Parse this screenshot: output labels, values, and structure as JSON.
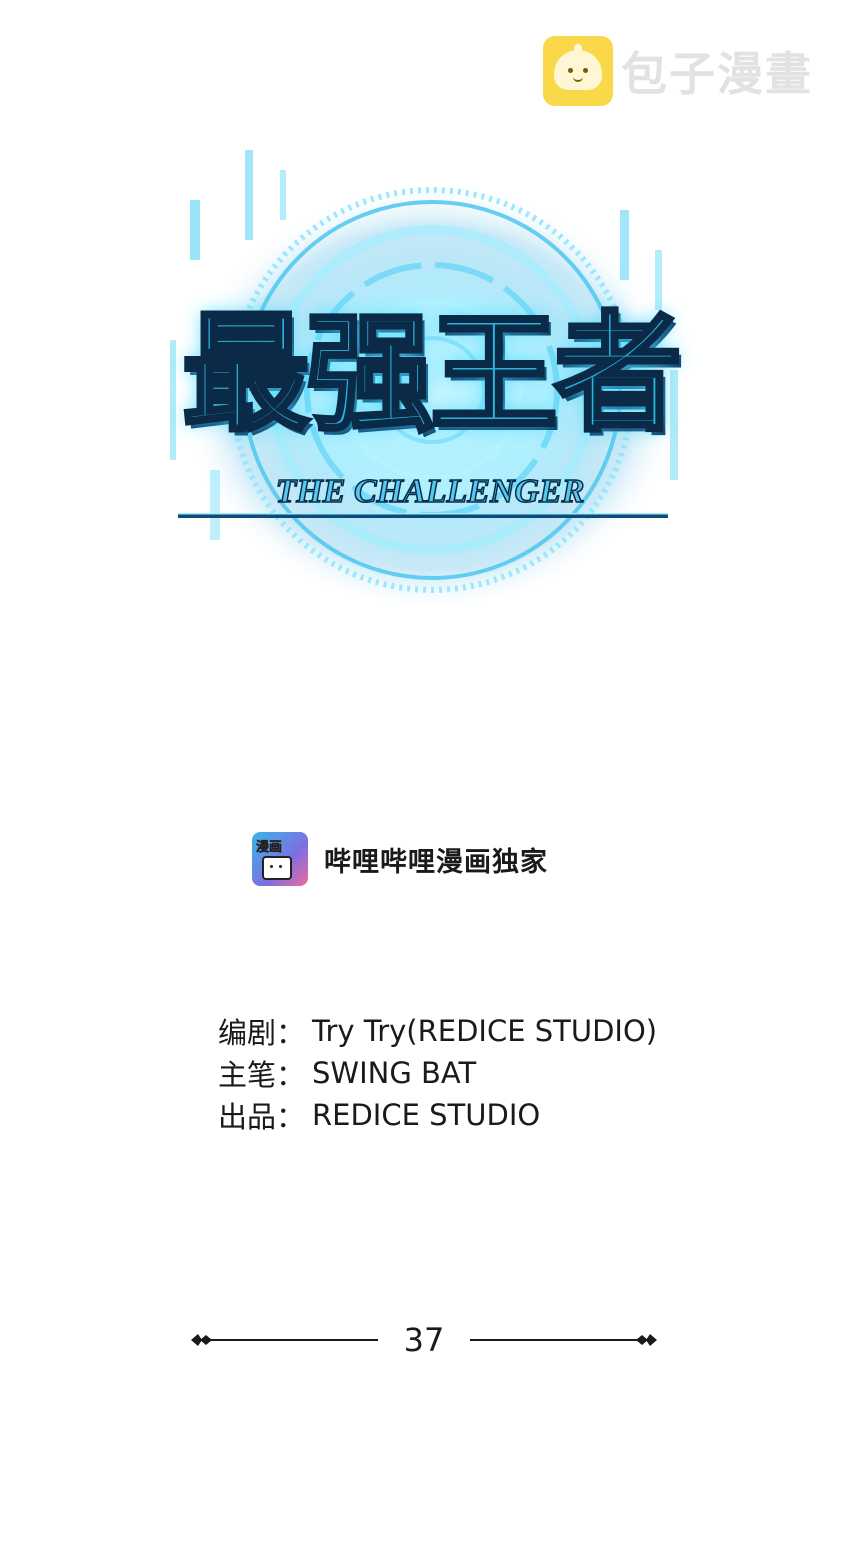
{
  "watermark": {
    "icon": "steamed-bun-icon",
    "text": "包子漫畫"
  },
  "logo": {
    "title": "最强王者",
    "subtitle": "THE CHALLENGER",
    "colors": {
      "primary": "#2ab5dc",
      "outline": "#0a2a48",
      "glow": "#6fe3ff"
    }
  },
  "exclusive": {
    "icon": "bilibili-manga-app-icon",
    "icon_text": "漫画",
    "text": "哔哩哔哩漫画独家"
  },
  "credits": [
    {
      "label": "编剧：",
      "value": "Try Try(REDICE STUDIO)"
    },
    {
      "label": "主笔：",
      "value": "SWING BAT"
    },
    {
      "label": "出品：",
      "value": "REDICE STUDIO"
    }
  ],
  "chapter": {
    "number": "37"
  }
}
